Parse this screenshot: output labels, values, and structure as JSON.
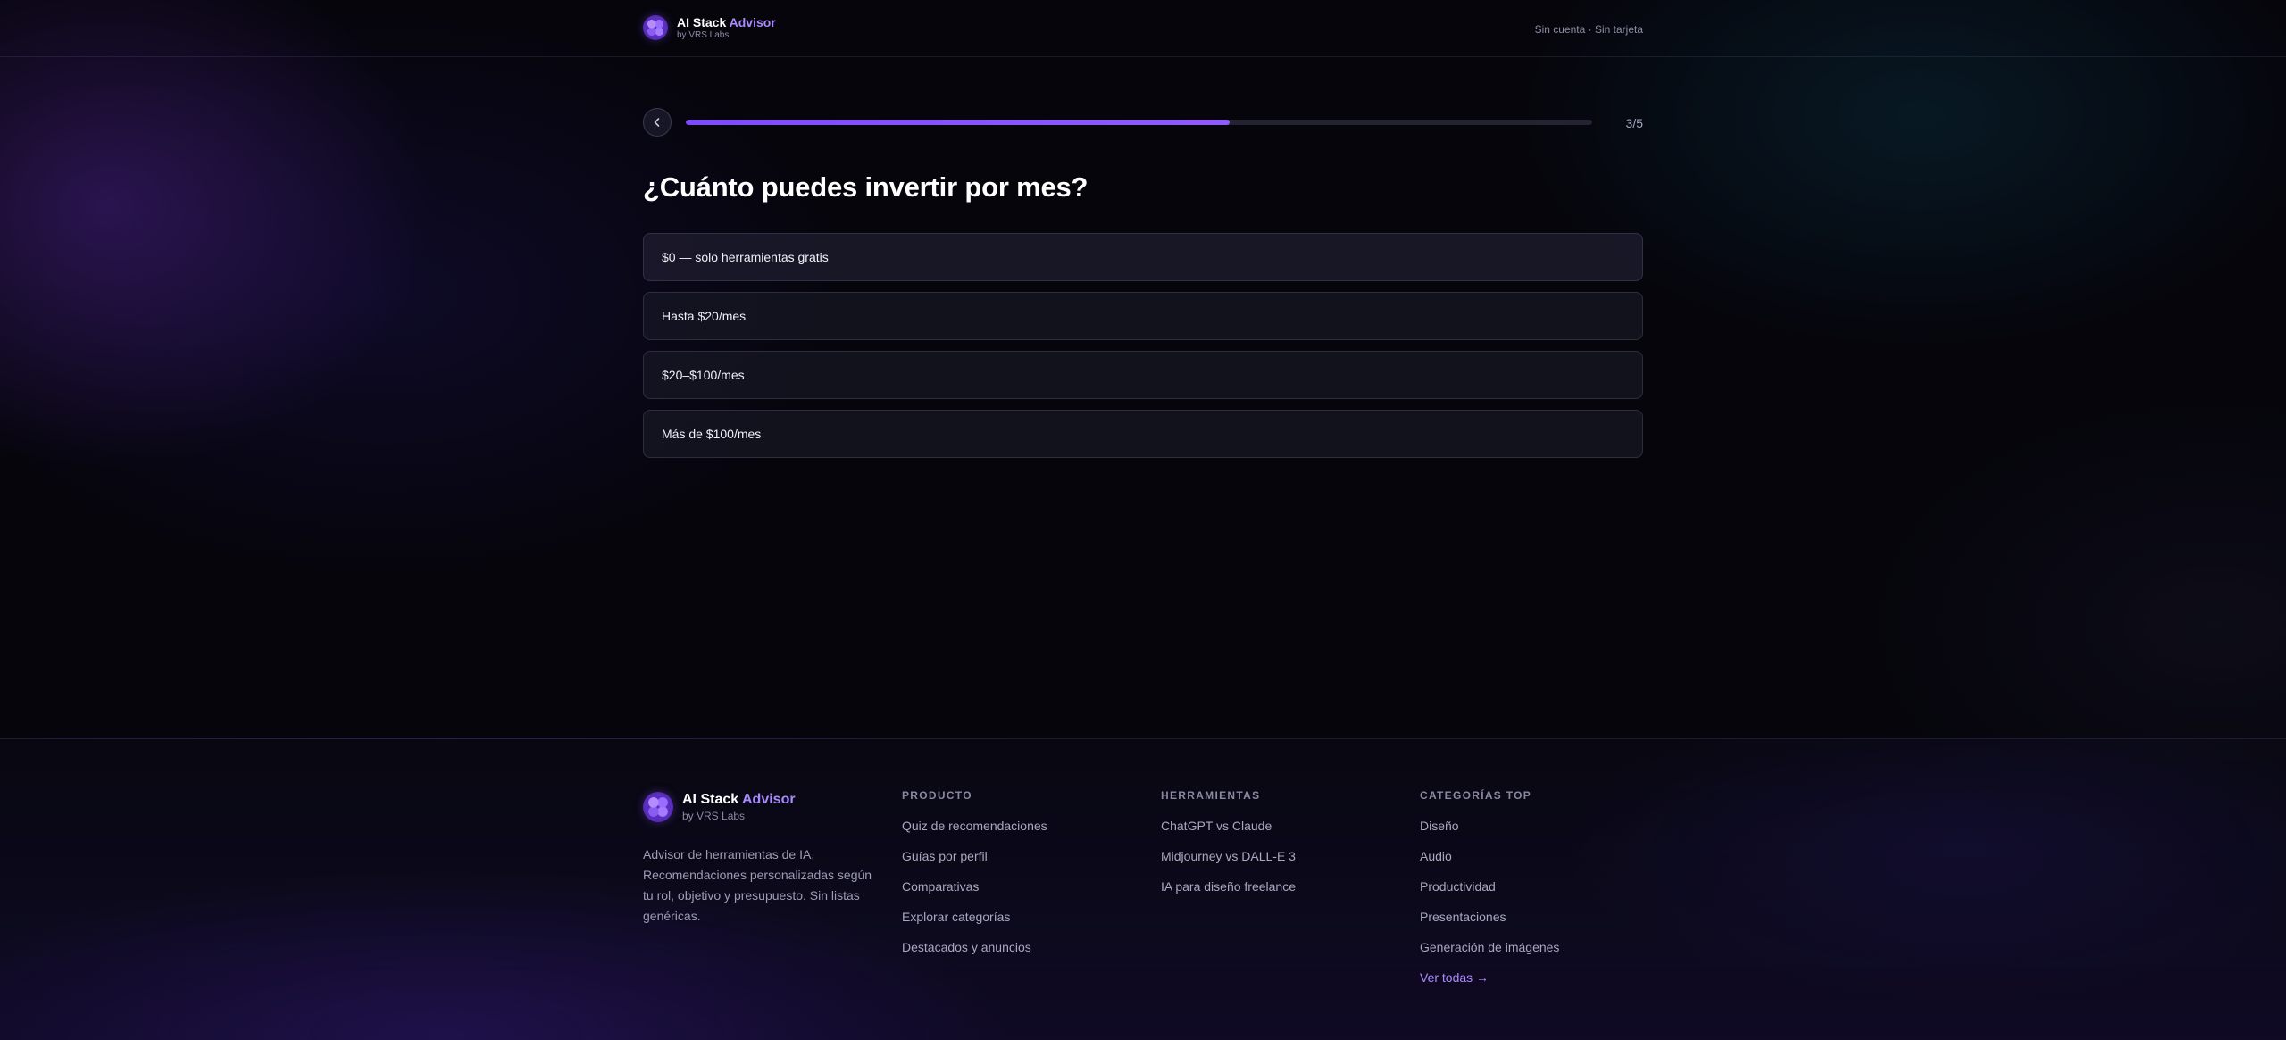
{
  "brand": {
    "name": "AI Stack",
    "accent": "Advisor",
    "byline": "by VRS Labs"
  },
  "header": {
    "note": "Sin cuenta · Sin tarjeta"
  },
  "quiz": {
    "back_icon": "chevron-left-icon",
    "progress_percent": 60,
    "step": "3/5",
    "question": "¿Cuánto puedes invertir por mes?",
    "options": [
      "$0 — solo herramientas gratis",
      "Hasta $20/mes",
      "$20–$100/mes",
      "Más de $100/mes"
    ]
  },
  "footer": {
    "description": "Advisor de herramientas de IA. Recomendaciones personalizadas según tu rol, objetivo y presupuesto. Sin listas genéricas.",
    "columns": [
      {
        "title": "PRODUCTO",
        "links": [
          "Quiz de recomendaciones",
          "Guías por perfil",
          "Comparativas",
          "Explorar categorías",
          "Destacados y anuncios"
        ]
      },
      {
        "title": "HERRAMIENTAS",
        "links": [
          "ChatGPT vs Claude",
          "Midjourney vs DALL-E 3",
          "IA para diseño freelance"
        ]
      },
      {
        "title": "CATEGORÍAS TOP",
        "links": [
          "Diseño",
          "Audio",
          "Productividad",
          "Presentaciones",
          "Generación de imágenes"
        ],
        "more_link": "Ver todas →"
      }
    ]
  },
  "colors": {
    "accent": "#a98bff",
    "progress": "#7c4bff",
    "background": "#06050c"
  }
}
